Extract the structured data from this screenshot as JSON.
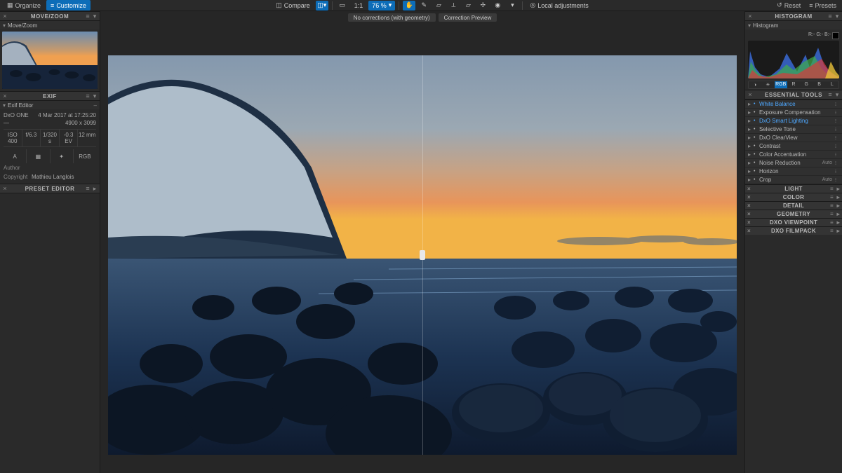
{
  "topbar": {
    "organize_label": "Organize",
    "customize_label": "Customize",
    "compare_label": "Compare",
    "one_to_one_label": "1:1",
    "zoom_value": "76 %",
    "local_adj_label": "Local adjustments",
    "reset_label": "Reset",
    "presets_label": "Presets"
  },
  "compare": {
    "left_label": "No corrections (with geometry)",
    "right_label": "Correction Preview"
  },
  "left": {
    "movezoom_title": "MOVE/ZOOM",
    "exif_title": "EXIF",
    "exif_editor_label": "Exif Editor",
    "camera": "DxO ONE",
    "datetime": "4 Mar 2017 at 17:25:20",
    "dimensions": "4900 x 3099",
    "dash": "—",
    "iso": "ISO 400",
    "aperture": "f/6.3",
    "shutter": "1/320 s",
    "ev": "-0.3 EV",
    "focal": "12 mm",
    "mode_a": "A",
    "mode_matrix": "▦",
    "mode_flash": "✦",
    "mode_rgb": "RGB",
    "author_label": "Author",
    "copyright_label": "Copyright",
    "copyright_value": "Mathieu Langlois",
    "preset_title": "PRESET EDITOR"
  },
  "right": {
    "hist_title": "HISTOGRAM",
    "hist_sub": "Histogram",
    "rgb_readout_r": "R:-",
    "rgb_readout_g": "G:-",
    "rgb_readout_b": "B:-",
    "channels": [
      "RGB",
      "R",
      "G",
      "B",
      "L"
    ],
    "essential_title": "ESSENTIAL TOOLS",
    "tools": [
      {
        "label": "White Balance",
        "auto": "",
        "hl": "blue"
      },
      {
        "label": "Exposure Compensation",
        "auto": ""
      },
      {
        "label": "DxO Smart Lighting",
        "auto": "",
        "hl": "blue"
      },
      {
        "label": "Selective Tone",
        "auto": ""
      },
      {
        "label": "DxO ClearView",
        "auto": ""
      },
      {
        "label": "Contrast",
        "auto": ""
      },
      {
        "label": "Color Accentuation",
        "auto": ""
      },
      {
        "label": "Noise Reduction",
        "auto": "Auto"
      },
      {
        "label": "Horizon",
        "auto": ""
      },
      {
        "label": "Crop",
        "auto": "Auto"
      }
    ],
    "categories": [
      "LIGHT",
      "COLOR",
      "DETAIL",
      "GEOMETRY",
      "DXO VIEWPOINT",
      "DXO FILMPACK"
    ]
  }
}
